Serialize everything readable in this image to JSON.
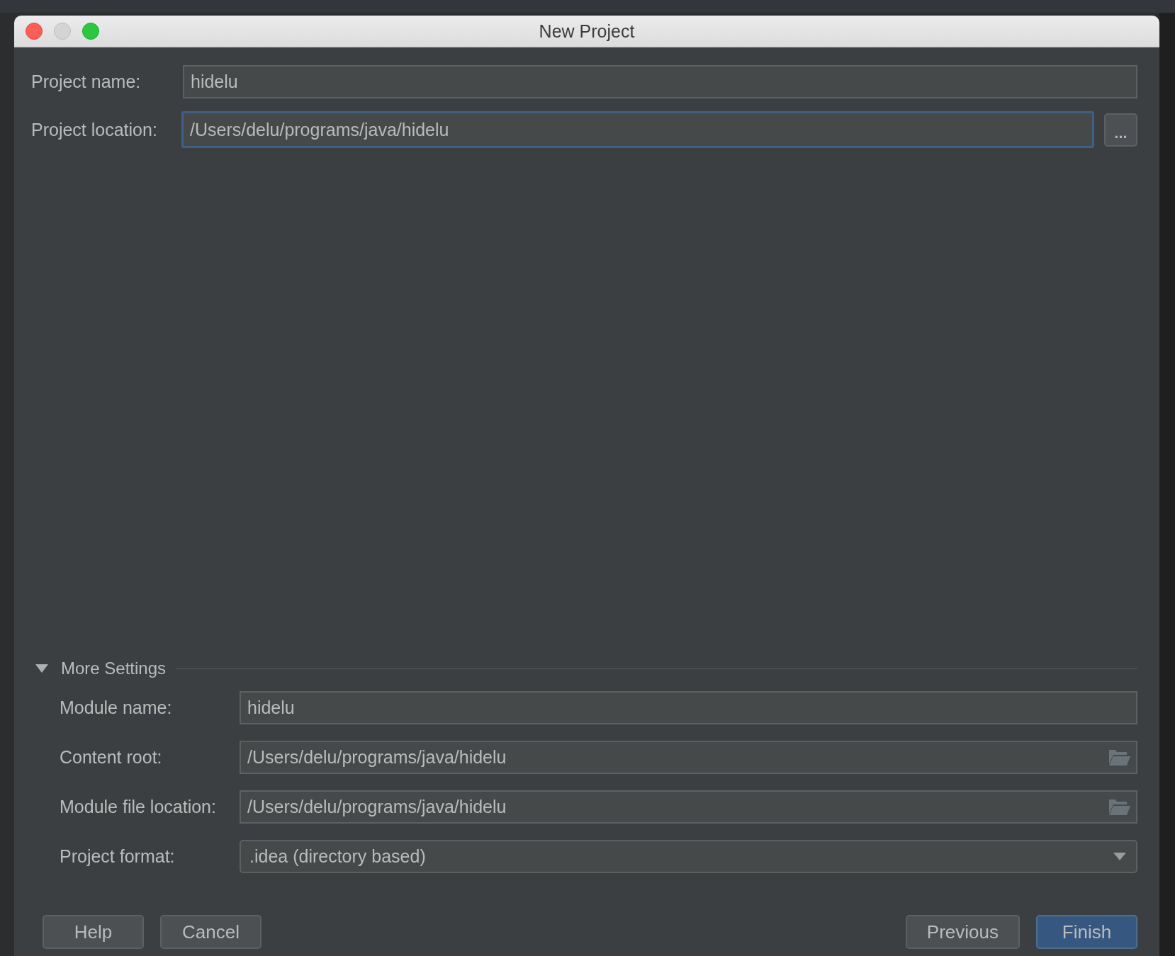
{
  "window": {
    "title": "New Project"
  },
  "fields": [
    {
      "label": "Project name:",
      "value": "hidelu",
      "focused": false,
      "browse": false
    },
    {
      "label": "Project location:",
      "value": "/Users/delu/programs/java/hidelu",
      "focused": true,
      "browse": true,
      "browse_label": "..."
    }
  ],
  "more_settings": {
    "label": "More Settings",
    "expanded": true,
    "fields": [
      {
        "kind": "text",
        "label": "Module name:",
        "value": "hidelu"
      },
      {
        "kind": "folder",
        "label": "Content root:",
        "value": "/Users/delu/programs/java/hidelu"
      },
      {
        "kind": "folder",
        "label": "Module file location:",
        "value": "/Users/delu/programs/java/hidelu"
      },
      {
        "kind": "dropdown",
        "label": "Project format:",
        "value": ".idea (directory based)"
      }
    ]
  },
  "buttons_left": [
    {
      "label": "Help",
      "default": false
    },
    {
      "label": "Cancel",
      "default": false
    }
  ],
  "buttons_right": [
    {
      "label": "Previous",
      "default": false
    },
    {
      "label": "Finish",
      "default": true
    }
  ]
}
